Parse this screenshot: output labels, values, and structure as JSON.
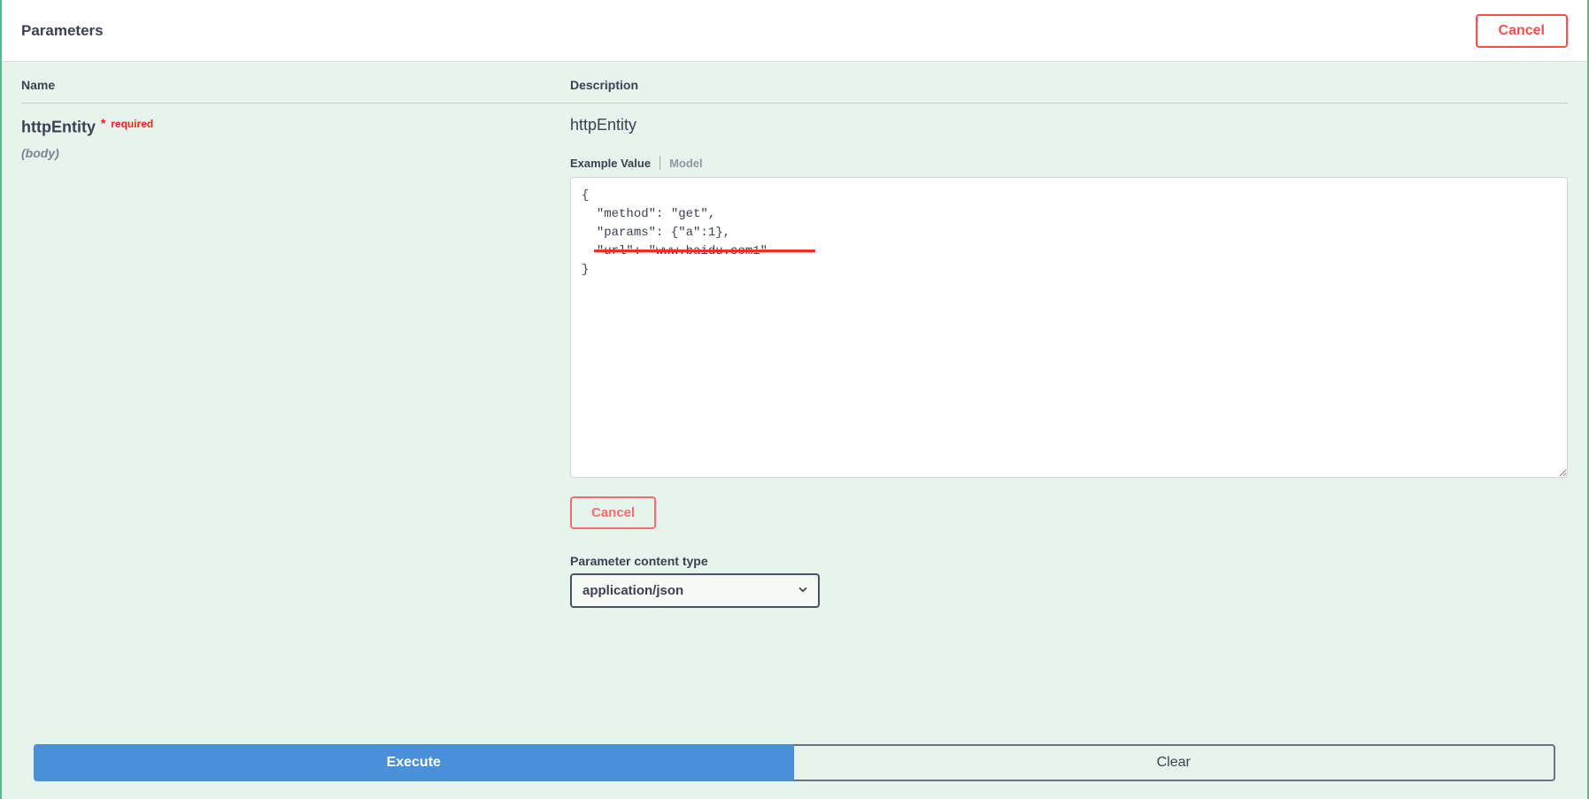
{
  "header": {
    "title": "Parameters",
    "cancel_label": "Cancel"
  },
  "columns": {
    "name": "Name",
    "description": "Description"
  },
  "param": {
    "name": "httpEntity",
    "required_star": "*",
    "required_label": "required",
    "in": "(body)"
  },
  "body": {
    "desc": "httpEntity",
    "tab_example": "Example Value",
    "tab_model": "Model",
    "value": "{\n  \"method\": \"get\",\n  \"params\": {\"a\":1},\n  \"url\": \"www.baidu.com1\"\n}",
    "cancel_label": "Cancel",
    "content_type_label": "Parameter content type",
    "content_type_value": "application/json"
  },
  "actions": {
    "execute": "Execute",
    "clear": "Clear"
  },
  "colors": {
    "accent_red": "#ff4d4f",
    "accent_blue": "#4a90d9",
    "bg_mint": "#e6f4ed"
  }
}
